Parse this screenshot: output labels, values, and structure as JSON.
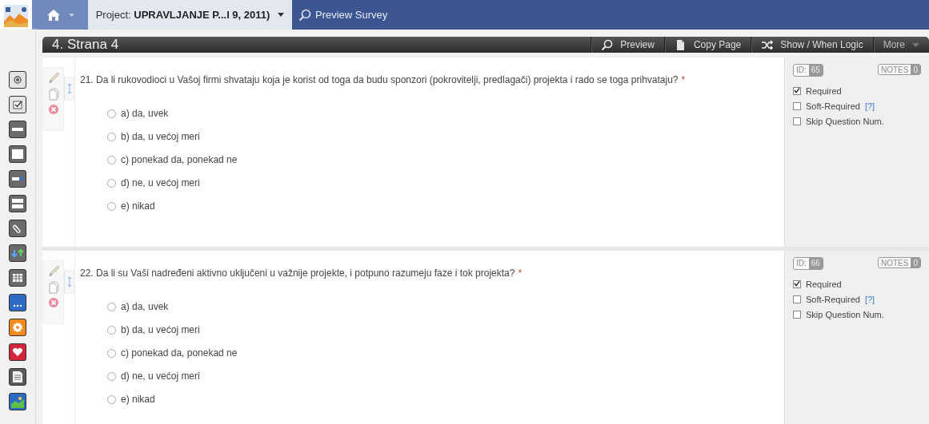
{
  "top_bar": {
    "project_label": "Project:",
    "project_name": "UPRAVLJANJE P...l 9, 2011)",
    "preview_survey": "Preview Survey"
  },
  "page_header": {
    "title": "4. Strana 4",
    "actions": [
      {
        "kind": "preview",
        "label": "Preview"
      },
      {
        "kind": "copy",
        "label": "Copy Page"
      },
      {
        "kind": "logic",
        "label": "Show / When Logic"
      },
      {
        "kind": "more",
        "label": "More"
      }
    ]
  },
  "toolbox": [
    {
      "kind": "radio"
    },
    {
      "kind": "checkbox"
    },
    {
      "kind": "textbox"
    },
    {
      "kind": "essay"
    },
    {
      "kind": "dropdown"
    },
    {
      "kind": "multiline"
    },
    {
      "kind": "attachment"
    },
    {
      "kind": "ranking"
    },
    {
      "kind": "grid"
    },
    {
      "kind": "dots"
    },
    {
      "kind": "settings"
    },
    {
      "kind": "heart"
    },
    {
      "kind": "document"
    },
    {
      "kind": "image"
    }
  ],
  "questions": [
    {
      "text": "21. Da li rukovodioci u Vašoj firmi shvataju koja je korist od toga da budu sponzori (pokrovitelji, predlagači) projekta i rado se toga prihvataju?",
      "required_mark": "*",
      "id_label": "ID:",
      "id": "65",
      "notes_label": "NOTES",
      "notes_count": "0",
      "options": [
        {
          "label": "a) da, uvek",
          "selected": false
        },
        {
          "label": "b) da, u većoj meri",
          "selected": false
        },
        {
          "label": "c) ponekad da, ponekad ne",
          "selected": false
        },
        {
          "label": "d) ne, u većoj meri",
          "selected": false
        },
        {
          "label": "e) nikad",
          "selected": false
        }
      ],
      "settings": [
        {
          "label": "Required",
          "checked": true
        },
        {
          "label": "Soft-Required",
          "help": "[?]",
          "checked": false
        },
        {
          "label": "Skip Question Num.",
          "checked": false
        }
      ]
    },
    {
      "text": "22. Da li su Vaši nadređeni aktivno uključeni u važnije projekte, i potpuno razumeju faze i tok projekta?",
      "required_mark": "*",
      "id_label": "ID:",
      "id": "66",
      "notes_label": "NOTES",
      "notes_count": "0",
      "options": [
        {
          "label": "a) da, uvek",
          "selected": false
        },
        {
          "label": "b) da, u većoj meri",
          "selected": false
        },
        {
          "label": "c) ponekad da, ponekad ne",
          "selected": false
        },
        {
          "label": "d) ne, u većoj meri",
          "selected": false
        },
        {
          "label": "e) nikad",
          "selected": false
        }
      ],
      "settings": [
        {
          "label": "Required",
          "checked": true
        },
        {
          "label": "Soft-Required",
          "help": "[?]",
          "checked": false
        },
        {
          "label": "Skip Question Num.",
          "checked": false
        }
      ]
    }
  ]
}
